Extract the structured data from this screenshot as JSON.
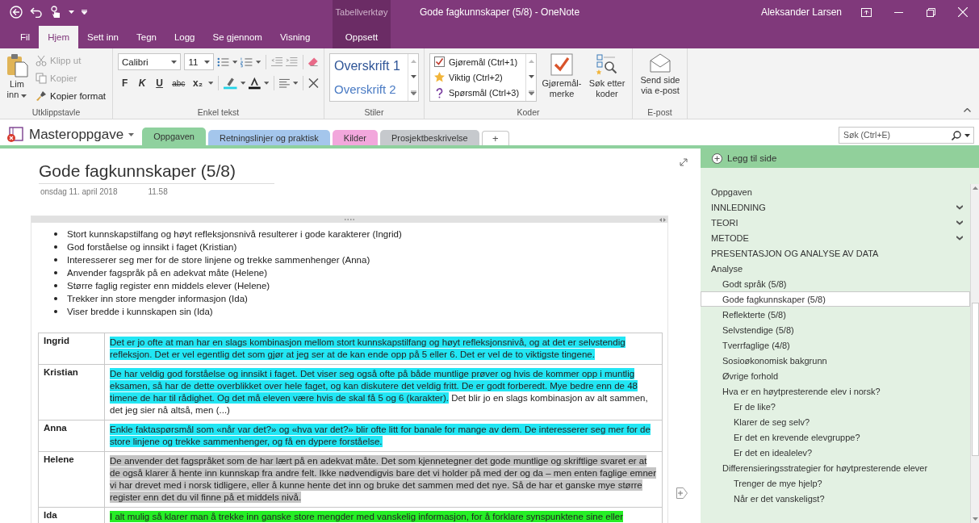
{
  "title_bar": {
    "context_label": "Tabellverktøy",
    "title": "Gode fagkunnskaper (5/8) - OneNote",
    "user": "Aleksander Larsen"
  },
  "ribbon_tabs": [
    {
      "label": "Fil",
      "selected": false,
      "contextual": false
    },
    {
      "label": "Hjem",
      "selected": true,
      "contextual": false
    },
    {
      "label": "Sett inn",
      "selected": false,
      "contextual": false
    },
    {
      "label": "Tegn",
      "selected": false,
      "contextual": false
    },
    {
      "label": "Logg",
      "selected": false,
      "contextual": false
    },
    {
      "label": "Se gjennom",
      "selected": false,
      "contextual": false
    },
    {
      "label": "Visning",
      "selected": false,
      "contextual": false
    },
    {
      "label": "Oppsett",
      "selected": false,
      "contextual": true
    }
  ],
  "ribbon_groups": [
    {
      "kind": "clipboard",
      "label": "Utklippstavle",
      "paste": "Lim inn",
      "items": [
        {
          "label": "Klipp ut",
          "disabled": true
        },
        {
          "label": "Kopier",
          "disabled": true
        },
        {
          "label": "Kopier format",
          "disabled": false
        }
      ]
    },
    {
      "kind": "text",
      "label": "Enkel tekst",
      "font": "Calibri",
      "size": "11",
      "format_buttons": [
        {
          "label": "F",
          "kind": "bold"
        },
        {
          "label": "K",
          "kind": "italic"
        },
        {
          "label": "U",
          "kind": "underline"
        },
        {
          "label": "abc",
          "kind": "strike"
        },
        {
          "label": "x₂",
          "kind": "subscript"
        }
      ]
    },
    {
      "kind": "styles",
      "label": "Stiler",
      "styles": [
        "Overskrift 1",
        "Overskrift 2"
      ]
    },
    {
      "kind": "tags",
      "label": "Koder",
      "tags": [
        {
          "label": "Gjøremål (Ctrl+1)",
          "kind": "todo"
        },
        {
          "label": "Viktig (Ctrl+2)",
          "kind": "important"
        },
        {
          "label": "Spørsmål (Ctrl+3)",
          "kind": "question"
        }
      ],
      "buttons": [
        {
          "label": "Gjøremål-merke",
          "kind": "todo"
        },
        {
          "label": "Søk etter koder",
          "kind": "find"
        }
      ]
    },
    {
      "kind": "email",
      "label": "E-post",
      "button": "Send side via e-post"
    }
  ],
  "notebook": {
    "name": "Masteroppgave",
    "sections": [
      {
        "label": "Oppgaven",
        "color": "#8fd19e",
        "selected": true
      },
      {
        "label": "Retningslinjer og praktisk",
        "color": "#a4c6ec",
        "selected": false
      },
      {
        "label": "Kilder",
        "color": "#f2a7dc",
        "selected": false
      },
      {
        "label": "Prosjektbeskrivelse",
        "color": "#c6c9cd",
        "selected": false
      }
    ],
    "add_section": "+",
    "search": {
      "placeholder": "Søk (Ctrl+E)"
    }
  },
  "page": {
    "title": "Gode fagkunnskaper (5/8)",
    "date": "onsdag 11. april 2018",
    "time": "11.58",
    "bullets": [
      "Stort kunnskapstilfang og høyt refleksjonsnivå resulterer i gode karakterer (Ingrid)",
      "God forståelse og innsikt i faget (Kristian)",
      "Interesserer seg mer for de store linjene og trekke sammenhenger (Anna)",
      "Anvender fagspråk på en adekvat måte (Helene)",
      "Større faglig register enn middels elever (Helene)",
      "Trekker inn store mengder informasjon (Ida)",
      "Viser bredde i kunnskapen sin (Ida)"
    ],
    "table": {
      "rows": [
        {
          "name": "Ingrid",
          "segments": [
            {
              "text": "Det er jo ofte at man har en slags kombinasjon mellom stort kunnskapstilfang og høyt refleksjonsnivå, og at det er selvstendig refleksjon. Det er vel egentlig det som gjør at jeg ser at de kan ende opp på 5 eller 6. Det er vel de to viktigste tingene.",
              "color": "#22e6f4"
            }
          ]
        },
        {
          "name": "Kristian",
          "segments": [
            {
              "text": "De har veldig god forståelse og innsikt i faget. Det viser seg også ofte på både muntlige prøver og hvis de kommer opp i muntlig eksamen, så har de dette overblikket over hele faget, og kan diskutere det veldig fritt. De er godt forberedt. Mye bedre enn de 48 timene de har til rådighet. Og det må eleven være hvis de skal få 5 og 6 (karakter).",
              "color": "#22e6f4"
            },
            {
              "text": " Det blir jo en slags kombinasjon av alt sammen, det jeg sier nå altså, men (...)"
            }
          ]
        },
        {
          "name": "Anna",
          "segments": [
            {
              "text": "Enkle faktaspørsmål som «når var det?» og «hva var det?» blir ofte litt for banale for mange av dem. De interesserer seg mer for de store linjene og trekke sammenhenger, og få en dypere forståelse.",
              "color": "#22e6f4"
            }
          ]
        },
        {
          "name": "Helene",
          "segments": [
            {
              "text": "De anvender det fagspråket som de har lært på en adekvat måte. Det som kjennetegner det gode muntlige og skriftlige svaret er at de også klarer å hente inn kunnskap fra andre felt. Ikke nødvendigvis bare det vi holder på med der og da – men enten faglige emner vi har drevet med i norsk tidligere, eller å kunne hente det inn og bruke det sammen med det nye. Så de har et ganske mye større register enn det du vil finne på et middels nivå.",
              "color": "#c4c4c4"
            }
          ]
        },
        {
          "name": "Ida",
          "segments": [
            {
              "text": "I alt mulig så klarer man å trekke inn ganske store mengder med vanskelig informasjon, for å forklare synspunktene sine eller",
              "color": "#26ee26"
            }
          ]
        }
      ]
    }
  },
  "page_list": {
    "add_page": "Legg til side",
    "pages": [
      {
        "label": "Oppgaven",
        "selected": false,
        "collapsed": false
      },
      {
        "label": "INNLEDNING",
        "selected": false,
        "collapsed": true
      },
      {
        "label": "TEORI",
        "selected": false,
        "collapsed": true
      },
      {
        "label": "METODE",
        "selected": false,
        "collapsed": true
      },
      {
        "label": "PRESENTASJON OG ANALYSE AV DATA",
        "selected": false,
        "collapsed": false
      },
      {
        "label": "Analyse",
        "selected": false,
        "collapsed": false,
        "children": [
          {
            "label": "Godt språk (5/8)",
            "selected": false
          },
          {
            "label": "Gode fagkunnskaper (5/8)",
            "selected": true
          },
          {
            "label": "Reflekterte (5/8)",
            "selected": false
          },
          {
            "label": "Selvstendige (5/8)",
            "selected": false
          },
          {
            "label": "Tverrfaglige (4/8)",
            "selected": false
          },
          {
            "label": "Sosioøkonomisk bakgrunn",
            "selected": false
          },
          {
            "label": "Øvrige forhold",
            "selected": false
          },
          {
            "label": "Hva er en høytpresterende elev i norsk?",
            "selected": false,
            "children": [
              {
                "label": "Er de like?",
                "selected": false
              },
              {
                "label": "Klarer de seg selv?",
                "selected": false
              },
              {
                "label": "Er det en krevende elevgruppe?",
                "selected": false
              },
              {
                "label": "Er det en idealelev?",
                "selected": false
              }
            ]
          },
          {
            "label": "Differensieringsstrategier for høytpresterende elever",
            "selected": false,
            "children": [
              {
                "label": "Trenger de mye hjelp?",
                "selected": false
              },
              {
                "label": "Når er det vanskeligst?",
                "selected": false
              }
            ]
          }
        ]
      }
    ]
  }
}
